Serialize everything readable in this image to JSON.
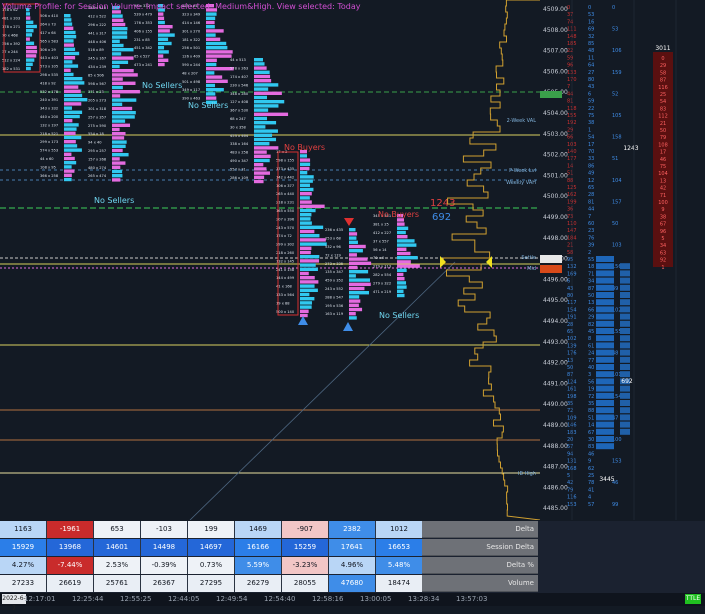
{
  "banner": "Volume Profile: for Session Volume. Impact selected: Medium&High. View selected: Today",
  "colors": {
    "background": "#131a24",
    "buy": "#31c8f0",
    "sell": "#e46be0",
    "neg": "#c32b2b",
    "pos": "#3f8de8",
    "text": "#ffffff"
  },
  "annotations": {
    "no_sellers": "No Sellers",
    "no_buyers": "No Buyers",
    "value_1243": "1243",
    "value_692": "692",
    "value_3445": "3445",
    "value_3011": "3011",
    "value_1243b": "1243",
    "value_692b": "692"
  },
  "price_labels": [
    "4509.00",
    "4508.00",
    "4507.00",
    "4506.00",
    "4505.00",
    "4504.00",
    "4503.00",
    "4502.00",
    "4501.00",
    "4500.00",
    "4499.00",
    "4498.00",
    "4497.00",
    "4496.00",
    "4495.00",
    "4494.00",
    "4493.00",
    "4492.00",
    "4491.00",
    "4490.00",
    "4489.00",
    "4488.00",
    "4487.00",
    "4486.00",
    "4485.00"
  ],
  "level_tags": [
    "2-Week VAL",
    "P-Week Lvl",
    "Weekly VAH",
    "Settle",
    "IB High",
    "Mid"
  ],
  "table": {
    "rows": [
      {
        "label": "Delta",
        "cells": [
          "1163",
          "-1961",
          "653",
          "-103",
          "199",
          "1469",
          "-907",
          "2382",
          "1012"
        ]
      },
      {
        "label": "Session Delta",
        "cells": [
          "15929",
          "13968",
          "14601",
          "14498",
          "14697",
          "16166",
          "15259",
          "17641",
          "16653"
        ]
      },
      {
        "label": "Delta %",
        "cells": [
          "4.27%",
          "-7.44%",
          "2.53%",
          "-0.39%",
          "0.73%",
          "5.59%",
          "-3.23%",
          "4.96%",
          "5.48%"
        ]
      },
      {
        "label": "Volume",
        "cells": [
          "27233",
          "26619",
          "25761",
          "26367",
          "27295",
          "26279",
          "28055",
          "47680",
          "18474"
        ]
      }
    ]
  },
  "time_axis": [
    "12:17:01",
    "12:25:44",
    "12:55:25",
    "12:44:05",
    "12:49:54",
    "12:54:40",
    "12:58:16",
    "13:00:05",
    "13:28:34",
    "13:57:03"
  ],
  "symbol": "2022-6-7",
  "status": "TTLE"
}
